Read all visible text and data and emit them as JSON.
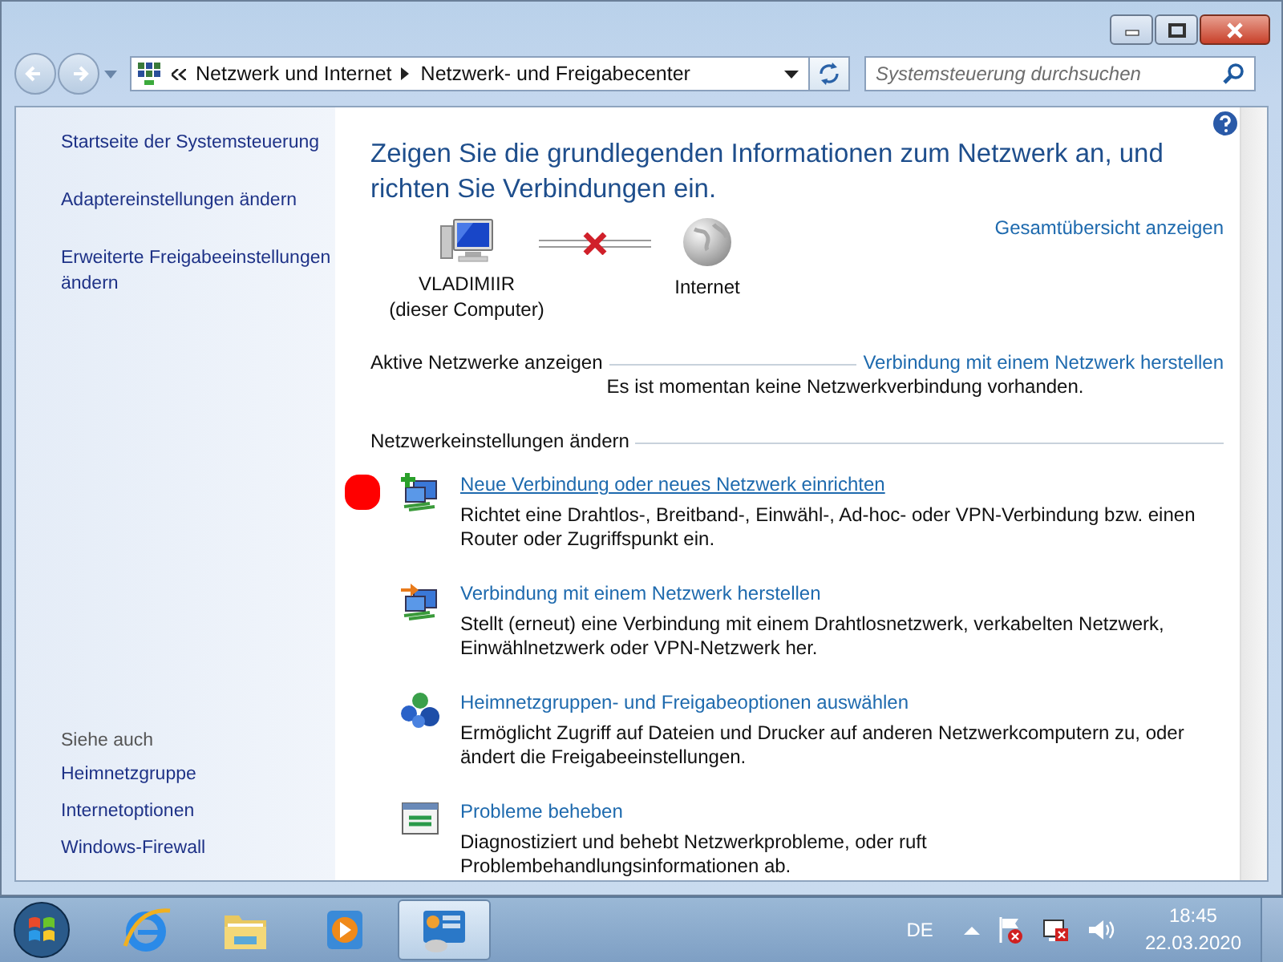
{
  "address": {
    "breadcrumbs": [
      "Netzwerk und Internet",
      "Netzwerk- und Freigabecenter"
    ],
    "search_placeholder": "Systemsteuerung durchsuchen"
  },
  "sidebar": {
    "links": [
      "Startseite der Systemsteuerung",
      "Adaptereinstellungen ändern",
      "Erweiterte Freigabeeinstellungen ändern"
    ],
    "see_also": {
      "title": "Siehe auch",
      "links": [
        "Heimnetzgruppe",
        "Internetoptionen",
        "Windows-Firewall"
      ]
    }
  },
  "main": {
    "heading": "Zeigen Sie die grundlegenden Informationen zum Netzwerk an, und richten Sie Verbindungen ein.",
    "full_map_link": "Gesamtübersicht anzeigen",
    "map": {
      "computer_name": "VLADIMIIR",
      "computer_note": "(dieser Computer)",
      "internet_label": "Internet",
      "connected": false
    },
    "active_networks": {
      "title": "Aktive Netzwerke anzeigen",
      "link": "Verbindung mit einem Netzwerk herstellen",
      "message": "Es ist momentan keine Netzwerkverbindung vorhanden."
    },
    "change_settings": {
      "title": "Netzwerkeinstellungen ändern",
      "tasks": [
        {
          "kind": "new",
          "title": "Neue Verbindung oder neues Netzwerk einrichten",
          "description": "Richtet eine Drahtlos-, Breitband-, Einwähl-, Ad-hoc- oder VPN-Verbindung bzw. einen Router oder Zugriffspunkt ein.",
          "hovered": true,
          "marked": true
        },
        {
          "kind": "connect",
          "title": "Verbindung mit einem Netzwerk herstellen",
          "description": "Stellt (erneut) eine Verbindung mit einem Drahtlosnetzwerk, verkabelten Netzwerk, Einwählnetzwerk oder VPN-Netzwerk her.",
          "hovered": false,
          "marked": false
        },
        {
          "kind": "homegroup",
          "title": "Heimnetzgruppen- und Freigabeoptionen auswählen",
          "description": "Ermöglicht Zugriff auf Dateien und Drucker auf anderen Netzwerkcomputern zu, oder ändert die Freigabeeinstellungen.",
          "hovered": false,
          "marked": false
        },
        {
          "kind": "troubleshoot",
          "title": "Probleme beheben",
          "description": "Diagnostiziert und behebt Netzwerkprobleme, oder ruft Problembehandlungsinformationen ab.",
          "hovered": false,
          "marked": false
        }
      ]
    }
  },
  "taskbar": {
    "apps": [
      {
        "kind": "ie",
        "selected": false
      },
      {
        "kind": "explorer",
        "selected": false
      },
      {
        "kind": "media",
        "selected": false
      },
      {
        "kind": "control",
        "selected": true
      }
    ],
    "language": "DE",
    "time": "18:45",
    "date": "22.03.2020"
  }
}
